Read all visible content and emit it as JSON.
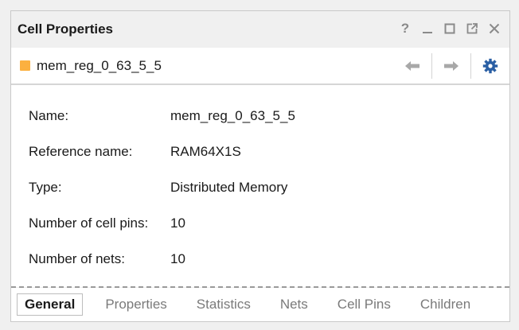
{
  "panel": {
    "title": "Cell Properties",
    "controls": {
      "help": "?",
      "minimize": "_"
    }
  },
  "toolbar": {
    "object_name": "mem_reg_0_63_5_5",
    "swatch_color": "#fbb040"
  },
  "properties": [
    {
      "label": "Name:",
      "value": "mem_reg_0_63_5_5"
    },
    {
      "label": "Reference name:",
      "value": "RAM64X1S"
    },
    {
      "label": "Type:",
      "value": "Distributed Memory"
    },
    {
      "label": "Number of cell pins:",
      "value": "10"
    },
    {
      "label": "Number of nets:",
      "value": "10"
    }
  ],
  "tabs": [
    {
      "label": "General",
      "active": true
    },
    {
      "label": "Properties",
      "active": false
    },
    {
      "label": "Statistics",
      "active": false
    },
    {
      "label": "Nets",
      "active": false
    },
    {
      "label": "Cell Pins",
      "active": false
    },
    {
      "label": "Children",
      "active": false
    }
  ],
  "colors": {
    "accent_gear": "#2a5fa4",
    "arrow_disabled": "#a8a8a8"
  }
}
